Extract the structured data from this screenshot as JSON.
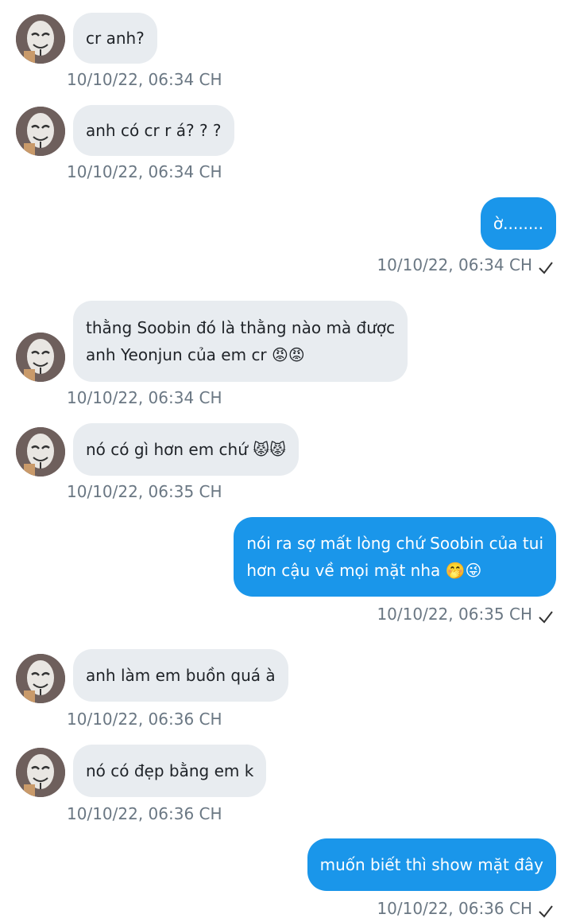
{
  "messages": [
    {
      "dir": "in",
      "lines": [
        "cr anh?"
      ],
      "time": "10/10/22,  06:34 CH"
    },
    {
      "dir": "in",
      "lines": [
        "anh có cr r á? ? ?"
      ],
      "time": "10/10/22,  06:34 CH"
    },
    {
      "dir": "out",
      "lines": [
        "ờ........"
      ],
      "time": "10/10/22,  06:34 CH",
      "read": true
    },
    {
      "dir": "in",
      "lines": [
        "thằng Soobin đó là thằng nào mà được",
        "anh Yeonjun của em cr 😡😡"
      ],
      "time": "10/10/22,  06:34 CH"
    },
    {
      "dir": "in",
      "lines": [
        "nó có gì hơn em chứ 😾😾"
      ],
      "time": "10/10/22,  06:35 CH"
    },
    {
      "dir": "out",
      "lines": [
        "nói ra sợ mất lòng chứ Soobin của tui",
        "hơn cậu về mọi mặt nha 🤭😜"
      ],
      "time": "10/10/22,  06:35 CH",
      "read": true
    },
    {
      "dir": "in",
      "lines": [
        "anh làm em buồn quá à"
      ],
      "time": "10/10/22,  06:36 CH"
    },
    {
      "dir": "in",
      "lines": [
        "nó có đẹp bằng em k"
      ],
      "time": "10/10/22,  06:36 CH"
    },
    {
      "dir": "out",
      "lines": [
        "muốn biết thì show mặt đây"
      ],
      "time": "10/10/22,  06:36 CH",
      "read": true
    }
  ],
  "icons": {
    "avatar": "guy-fawkes-mask-avatar",
    "read_receipt": "checkmark-icon"
  },
  "colors": {
    "incoming_bubble": "#e8ecf0",
    "outgoing_bubble": "#1a96ea",
    "timestamp": "#6a7783"
  }
}
